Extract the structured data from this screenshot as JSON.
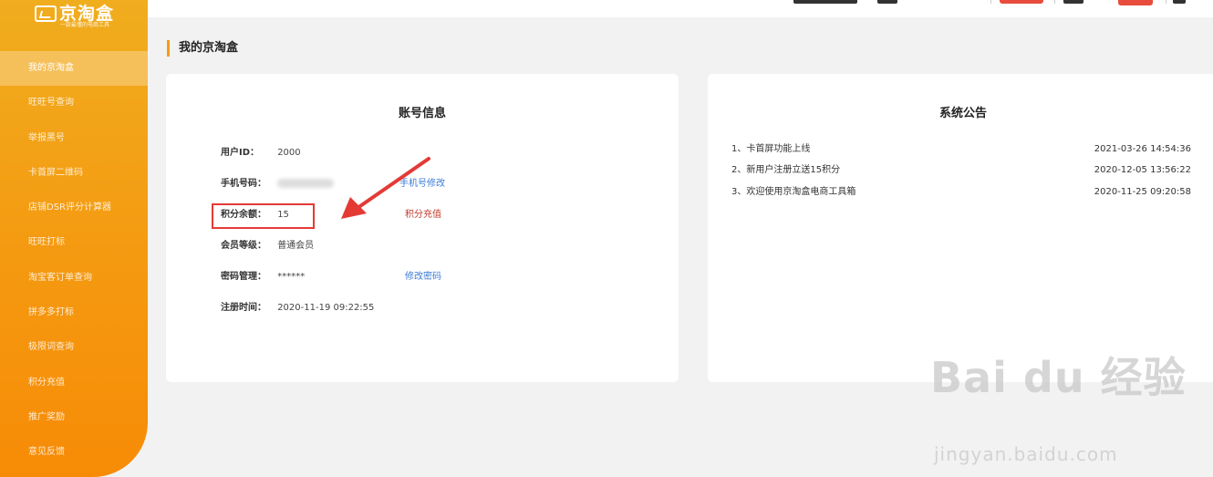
{
  "brand": {
    "name": "京淘盒",
    "tagline": "一款最懂的电商工具"
  },
  "sidebar": {
    "items": [
      {
        "label": "我的京淘盒",
        "active": true
      },
      {
        "label": "旺旺号查询",
        "active": false
      },
      {
        "label": "举报黑号",
        "active": false
      },
      {
        "label": "卡首屏二维码",
        "active": false
      },
      {
        "label": "店铺DSR评分计算器",
        "active": false
      },
      {
        "label": "旺旺打标",
        "active": false
      },
      {
        "label": "淘宝客订单查询",
        "active": false
      },
      {
        "label": "拼多多打标",
        "active": false
      },
      {
        "label": "极限词查询",
        "active": false
      },
      {
        "label": "积分充值",
        "active": false
      },
      {
        "label": "推广奖励",
        "active": false
      },
      {
        "label": "意见反馈",
        "active": false
      }
    ]
  },
  "page": {
    "title": "我的京淘盒"
  },
  "account": {
    "title": "账号信息",
    "fields": {
      "user_id": {
        "label": "用户ID：",
        "value": "2000"
      },
      "phone": {
        "label": "手机号码："
      },
      "points": {
        "label": "积分余额：",
        "value": "15"
      },
      "level": {
        "label": "会员等级：",
        "value": "普通会员"
      },
      "password": {
        "label": "密码管理：",
        "value": "******"
      },
      "register": {
        "label": "注册时间：",
        "value": "2020-11-19 09:22:55"
      }
    },
    "actions": {
      "change_phone": "手机号修改",
      "recharge": "积分充值",
      "change_password": "修改密码"
    }
  },
  "notice": {
    "title": "系统公告",
    "items": [
      {
        "text": "1、卡首屏功能上线",
        "time": "2021-03-26 14:54:36"
      },
      {
        "text": "2、新用户注册立送15积分",
        "time": "2020-12-05 13:56:22"
      },
      {
        "text": "3、欢迎使用京淘盒电商工具箱",
        "time": "2020-11-25 09:20:58"
      }
    ]
  },
  "watermark": {
    "main": "Bai du 经验",
    "url": "jingyan.baidu.com"
  },
  "colors": {
    "accent": "#f39c12",
    "highlight": "#e43a36",
    "link": "#3a7bd5"
  }
}
